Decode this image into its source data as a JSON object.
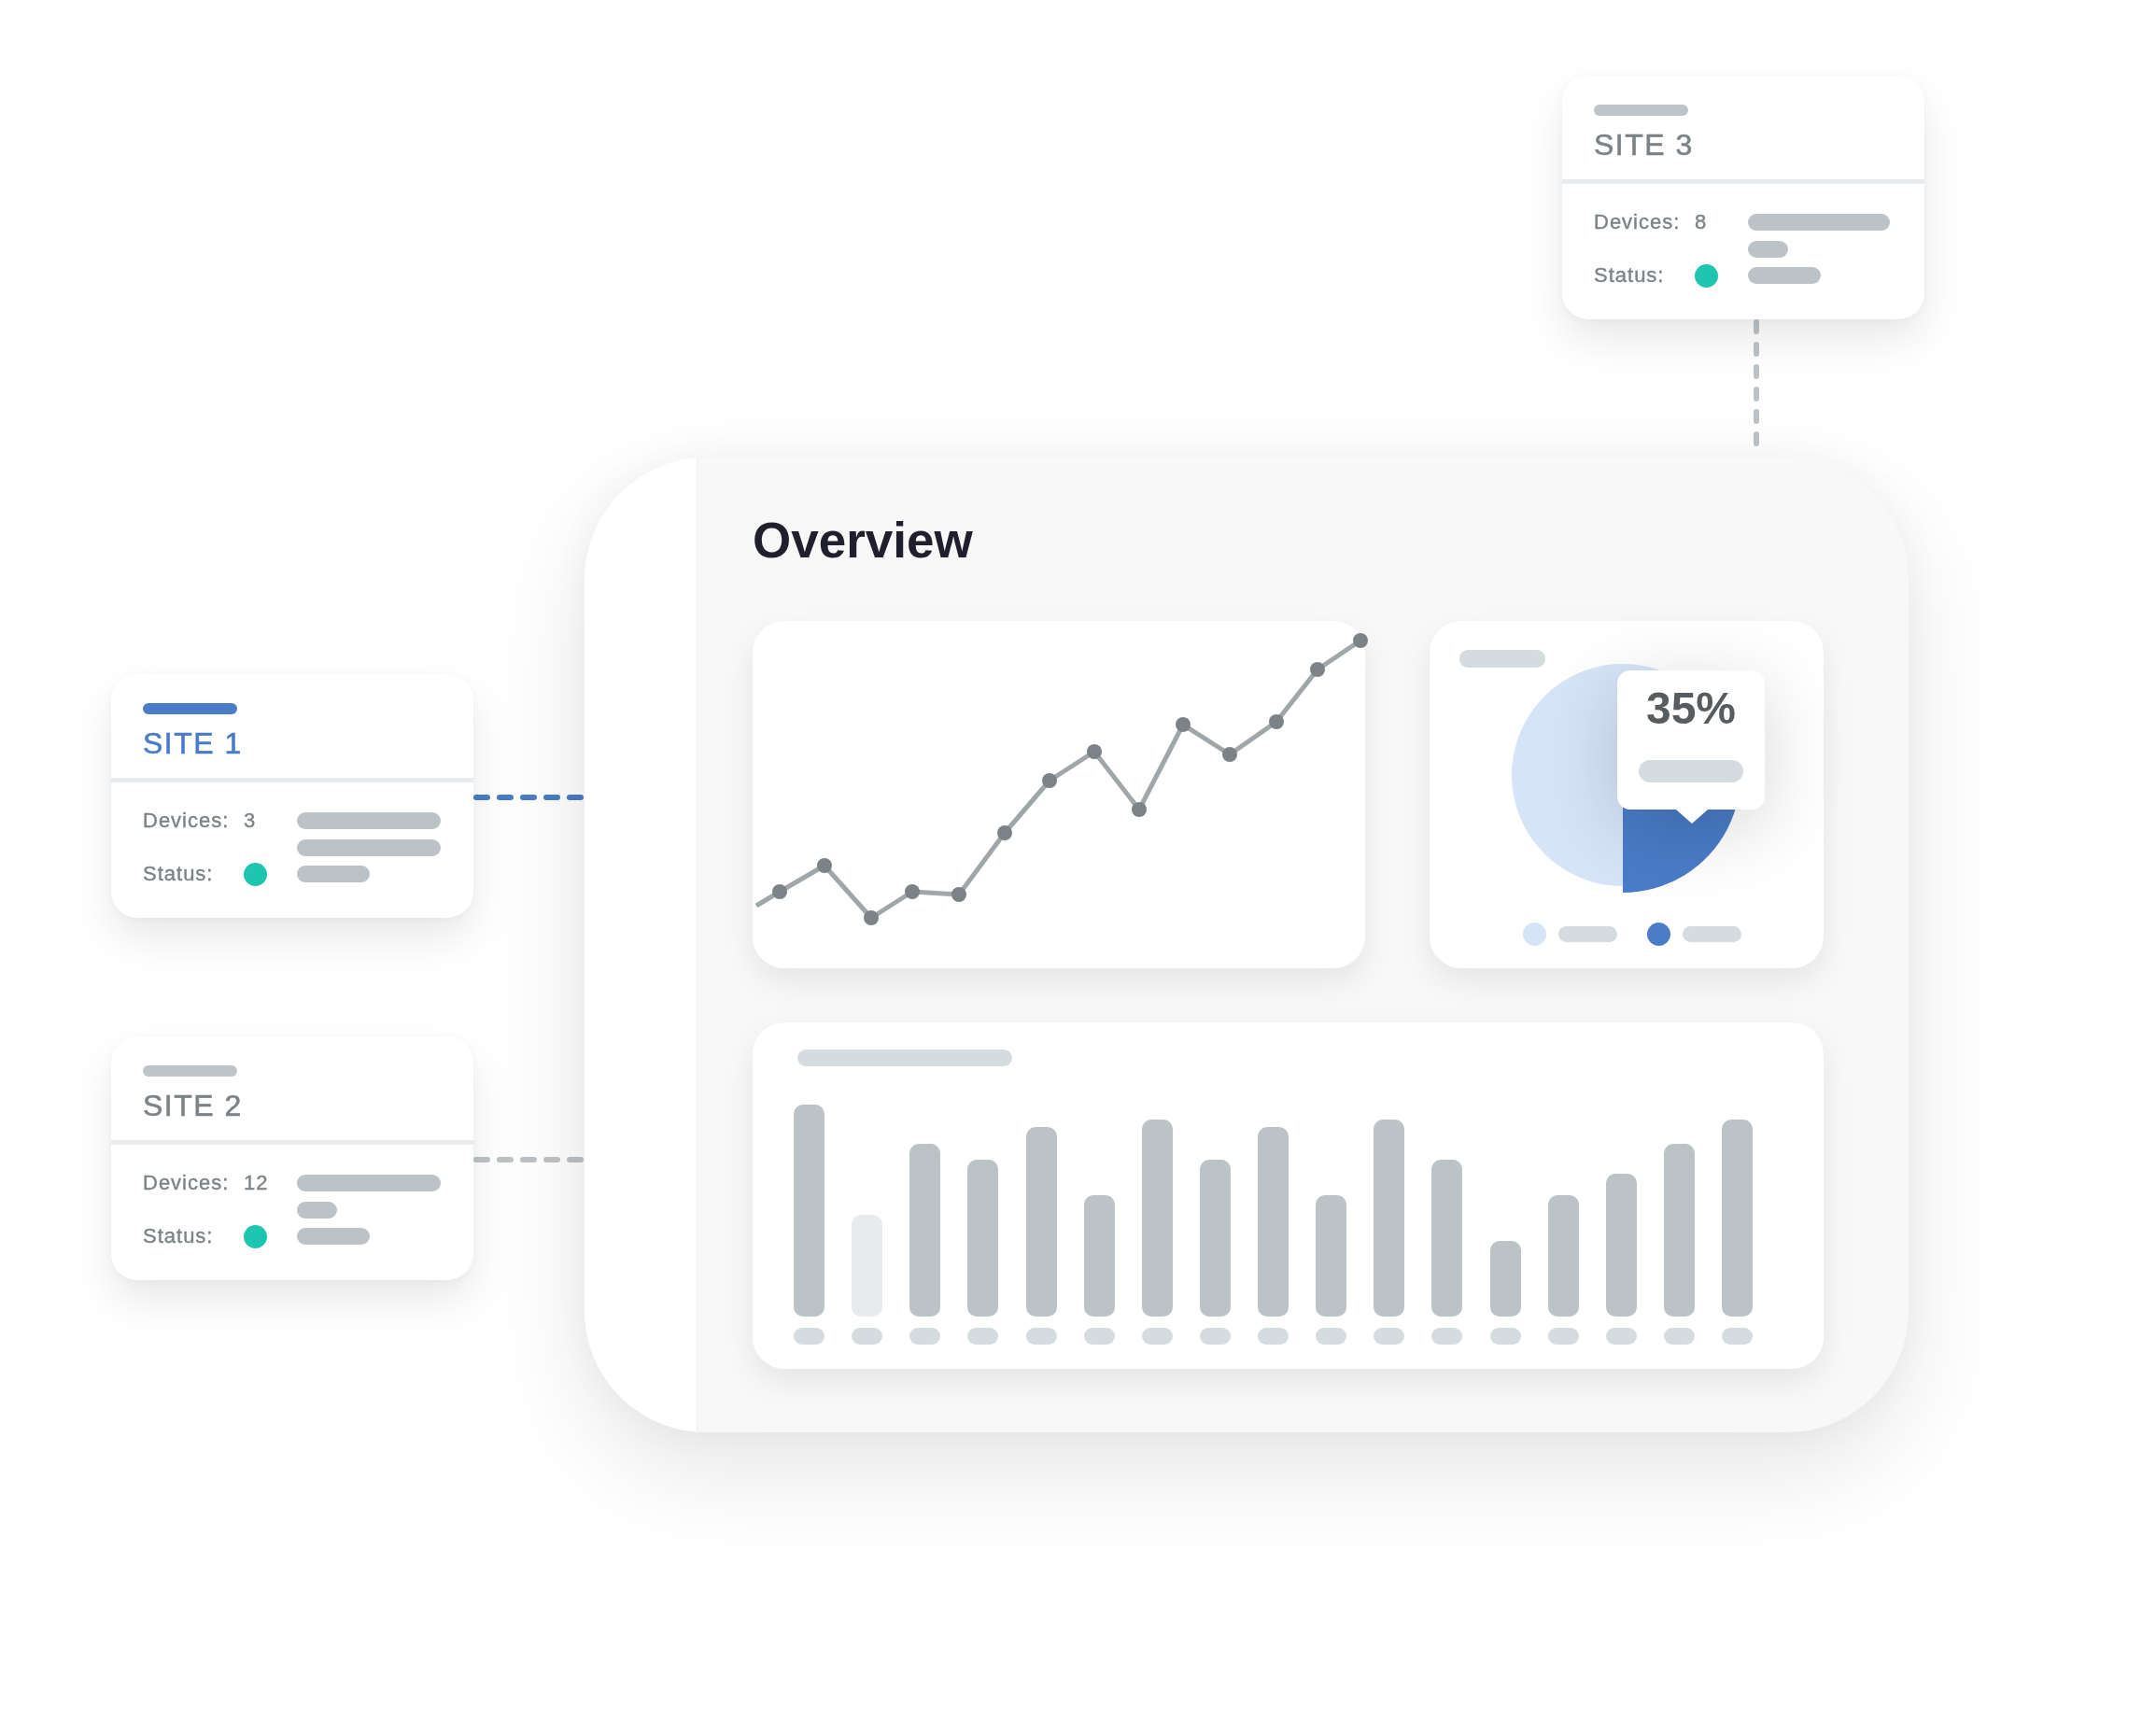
{
  "sites": [
    {
      "title": "SITE 1",
      "selected": true,
      "devices": {
        "label": "Devices:",
        "value": "3"
      },
      "status": {
        "label": "Status:",
        "color": "#1ec5af"
      }
    },
    {
      "title": "SITE 2",
      "selected": false,
      "devices": {
        "label": "Devices:",
        "value": "12"
      },
      "status": {
        "label": "Status:",
        "color": "#1ec5af"
      }
    },
    {
      "title": "SITE 3",
      "selected": false,
      "devices": {
        "label": "Devices:",
        "value": "8"
      },
      "status": {
        "label": "Status:",
        "color": "#1ec5af"
      }
    }
  ],
  "overview": {
    "title": "Overview",
    "pie": {
      "tooltip": "35%",
      "legend": [
        {
          "color": "#d6e4f8"
        },
        {
          "color": "#4a7cc7"
        }
      ]
    }
  }
}
